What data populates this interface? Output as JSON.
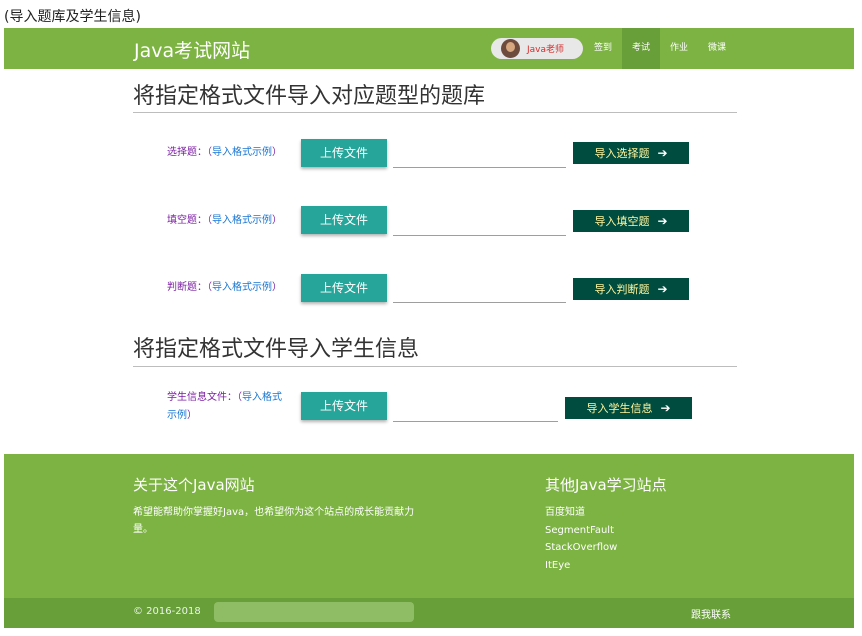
{
  "caption": "(导入题库及学生信息)",
  "navbar": {
    "brand": "Java考试网站",
    "user": "Java老师",
    "items": [
      "签到",
      "考试",
      "作业",
      "微课"
    ]
  },
  "section1": {
    "title": "将指定格式文件导入对应题型的题库",
    "rows": [
      {
        "label": "选择题：",
        "open": "（",
        "link": "导入格式示例",
        "close": "）",
        "upload": "上传文件",
        "import": "导入选择题"
      },
      {
        "label": "填空题：",
        "open": "（",
        "link": "导入格式示例",
        "close": "）",
        "upload": "上传文件",
        "import": "导入填空题"
      },
      {
        "label": "判断题：",
        "open": "（",
        "link": "导入格式示例",
        "close": "）",
        "upload": "上传文件",
        "import": "导入判断题"
      }
    ]
  },
  "section2": {
    "title": "将指定格式文件导入学生信息",
    "row": {
      "label": "学生信息文件：",
      "open": "（",
      "link1": "导入格式",
      "link2": "示例",
      "close": "）",
      "upload": "上传文件",
      "import": "导入学生信息"
    }
  },
  "footer": {
    "about_title": "关于这个Java网站",
    "about_text": "希望能帮助你掌握好Java，也希望你为这个站点的成长能贡献力量。",
    "links_title": "其他Java学习站点",
    "links": [
      "百度知道",
      "SegmentFault",
      "StackOverflow",
      "ItEye"
    ],
    "copyright": "© 2016-2018",
    "contact": "跟我联系"
  }
}
